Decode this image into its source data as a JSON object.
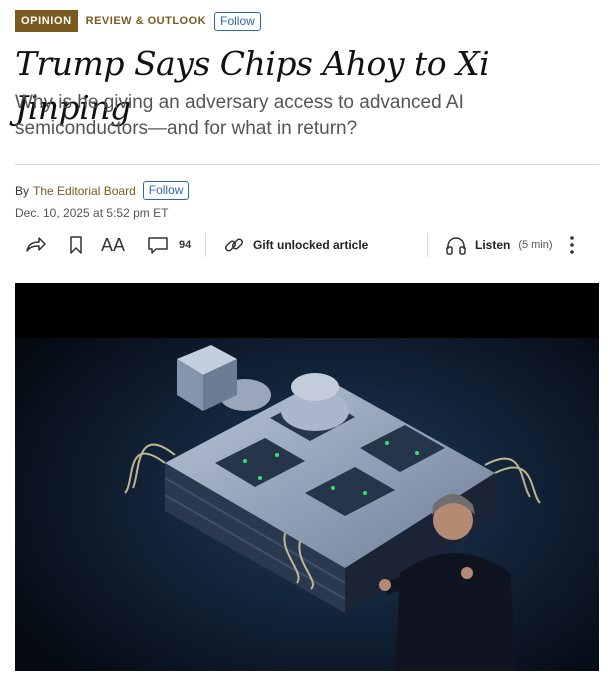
{
  "topline": {
    "badge": "OPINION",
    "section": "REVIEW & OUTLOOK",
    "follow": "Follow"
  },
  "article": {
    "headline": "Trump Says Chips Ahoy to Xi Jinping",
    "dek": "Why is he giving an adversary access to advanced AI semiconductors—and for what in return?",
    "byline_prefix": "By",
    "author": "The Editorial Board",
    "author_follow": "Follow",
    "date": "Dec. 10, 2025 at 5:52 pm ET"
  },
  "toolbar": {
    "share_icon": "share-icon",
    "bookmark_icon": "bookmark-icon",
    "text_size_label": "AA",
    "comment_icon": "comment-icon",
    "comment_count": "94",
    "gift_icon": "link-icon",
    "gift_label": "Gift unlocked article",
    "listen_icon": "headphones-icon",
    "listen_label": "Listen",
    "listen_duration": "(5 min)",
    "more_icon": "more-vertical-icon"
  },
  "image": {
    "subject": "hero-photo",
    "colors": {
      "bg": "#0b1a2e",
      "chip": "#7f8fa6",
      "accent_green": "#39e07a"
    }
  },
  "colors": {
    "brand": "#7a5a1e",
    "link": "#2a68b1",
    "rule": "#d8d8d8"
  }
}
